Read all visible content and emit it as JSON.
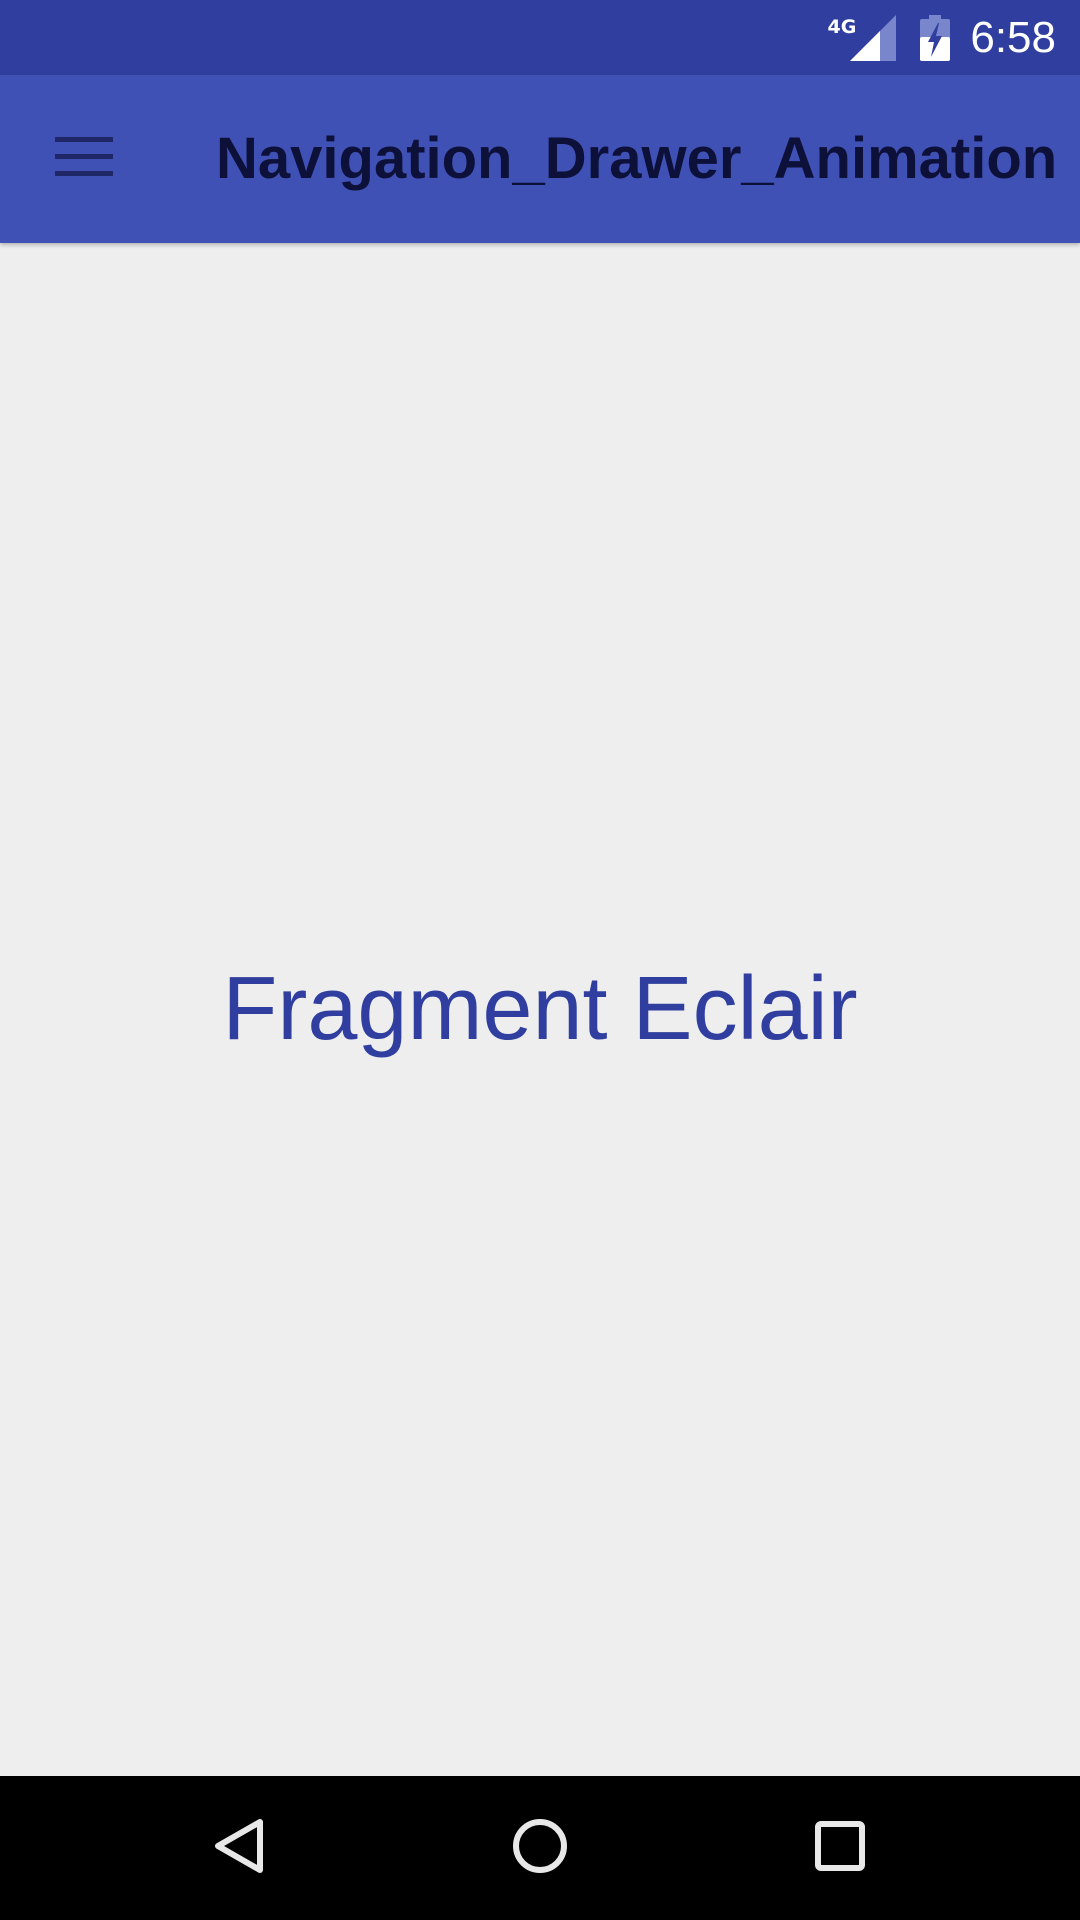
{
  "status_bar": {
    "network_type": "4G",
    "time": "6:58",
    "icons": [
      "signal-icon",
      "battery-charging-icon"
    ],
    "background": "#303f9f"
  },
  "app_bar": {
    "title": "Navigation_Drawer_Animation",
    "menu_icon": "hamburger-menu-icon",
    "background": "#3f51b5",
    "title_color": "#0d1038"
  },
  "main": {
    "fragment_label": "Fragment Eclair",
    "label_color": "#303f9f",
    "background": "#eeeeef"
  },
  "nav_bar": {
    "icons": [
      "back-icon",
      "home-icon",
      "recents-icon"
    ],
    "background": "#000000"
  }
}
